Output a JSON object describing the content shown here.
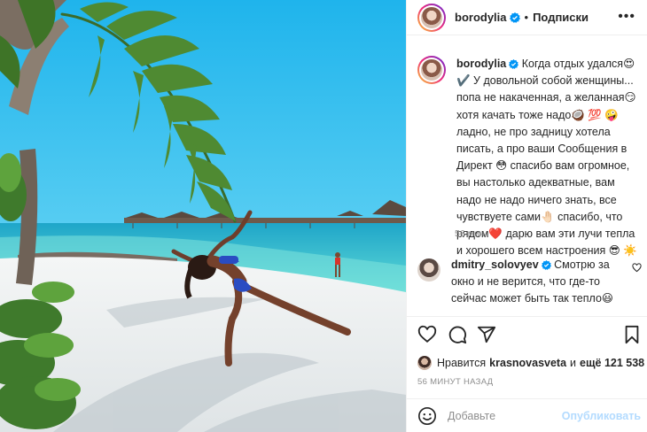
{
  "post": {
    "author": {
      "username": "borodylia",
      "verified": true,
      "follow_status": "Подписки"
    },
    "photo": {
      "description_icon": "photo-beach-palm"
    },
    "caption": {
      "username": "borodylia",
      "text": "Когда отдых удался😍 ✔️ У довольной собой женщины... попа не накаченная, а желанная😏 хотя качать тоже надо🥥 💯 🤪 ладно, не про задницу хотела писать, а про ваши Сообщения в Директ 😳 спасибо вам огромное, вы настолько адекватные, вам надо не надо ничего знать, все чувствуете сами🤚🏻 спасибо, что рядом❤️ дарю вам эти лучи тепла и хорошего всем настроения 😎 ☀️",
      "time": "56 мин."
    },
    "comment": {
      "username": "dmitry_solovyev",
      "verified": true,
      "text": "Смотрю за окно и не верится, что где-то сейчас может быть так тепло😃"
    },
    "likes": {
      "prefix": "Нравится",
      "user": "krasnovasveta",
      "and": "и",
      "rest": "ещё 121 538"
    },
    "post_time": "56 МИНУТ НАЗАД",
    "add_comment": {
      "placeholder": "Добавьте",
      "publish": "Опубликовать"
    },
    "more_menu": "•••",
    "separator": "•"
  },
  "colors": {
    "verified_blue": "#0095f6",
    "publish_disabled": "#b3dbff",
    "muted": "#8e8e8e",
    "text": "#262626"
  }
}
